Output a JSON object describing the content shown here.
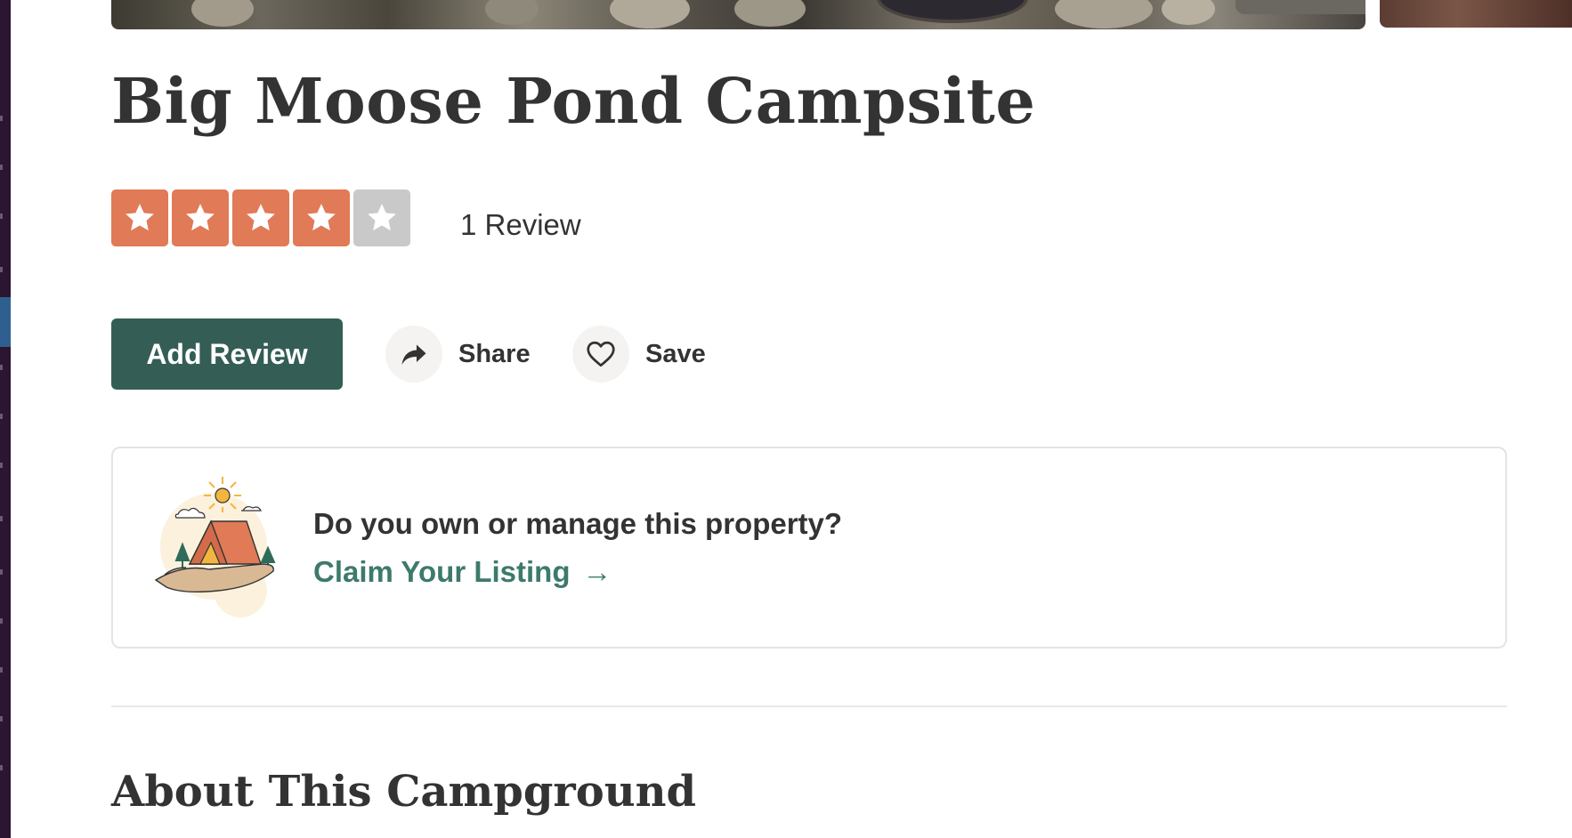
{
  "campsite": {
    "title": "Big Moose Pond Campsite",
    "rating": 4,
    "rating_max": 5,
    "review_count_label": "1 Review"
  },
  "actions": {
    "add_review_label": "Add Review",
    "share_label": "Share",
    "save_label": "Save"
  },
  "claim": {
    "question": "Do you own or manage this property?",
    "link_label": "Claim Your Listing",
    "link_arrow": "→"
  },
  "sections": {
    "about_title": "About This Campground"
  },
  "colors": {
    "star_filled": "#e07a57",
    "star_empty": "#c9c9c9",
    "primary_button": "#345e55",
    "link": "#3d7a6b"
  },
  "icons": {
    "share": "share-arrow-icon",
    "save": "heart-icon",
    "star": "star-icon",
    "claim": "tent-in-hand-illustration"
  }
}
